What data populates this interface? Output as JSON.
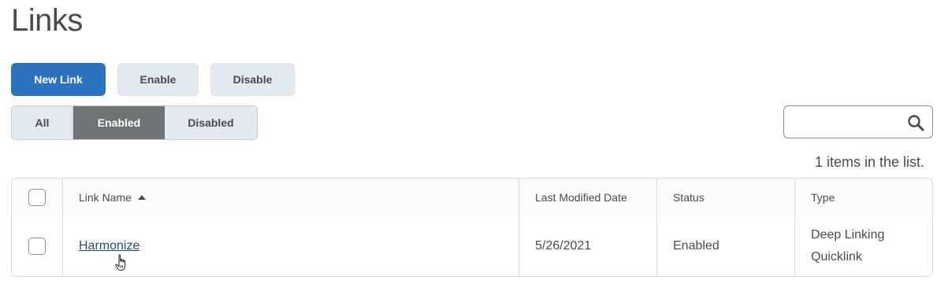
{
  "page": {
    "title": "Links"
  },
  "toolbar": {
    "new_link_label": "New Link",
    "enable_label": "Enable",
    "disable_label": "Disable"
  },
  "filters": {
    "all_label": "All",
    "enabled_label": "Enabled",
    "disabled_label": "Disabled",
    "selected": "Enabled"
  },
  "search": {
    "value": "",
    "placeholder": "",
    "icon": "search-icon"
  },
  "list": {
    "count_text": "1 items in the list."
  },
  "table": {
    "headers": {
      "name": "Link Name",
      "modified": "Last Modified Date",
      "status": "Status",
      "type": "Type"
    },
    "rows": [
      {
        "name": "Harmonize",
        "modified": "5/26/2021",
        "status": "Enabled",
        "type_line1": "Deep Linking",
        "type_line2": "Quicklink"
      }
    ]
  },
  "colors": {
    "primary": "#2b73be",
    "selected_filter": "#6e7376",
    "link": "#1e4d8c"
  }
}
